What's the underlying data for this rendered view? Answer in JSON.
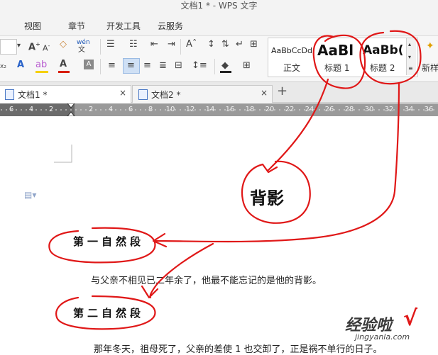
{
  "window": {
    "title": "文档1 * - WPS 文字"
  },
  "menu": {
    "items": [
      "视图",
      "章节",
      "开发工具",
      "云服务"
    ]
  },
  "ribbon": {
    "font_grow": "A",
    "font_shrink": "A",
    "pinyin": "wén",
    "styles": [
      {
        "preview": "AaBbCcDd",
        "label": "正文"
      },
      {
        "preview": "AaBl",
        "label": "标题 1"
      },
      {
        "preview": "AaBb(",
        "label": "标题 2"
      }
    ],
    "new_style": "新样"
  },
  "tabs": [
    {
      "label": "文档1 *",
      "close": "×"
    },
    {
      "label": "文档2 *",
      "close": "×"
    }
  ],
  "new_tab": "+",
  "ruler": {
    "left_ticks": [
      "6",
      "4",
      "2"
    ],
    "right_ticks": [
      "2",
      "4",
      "6",
      "8",
      "10",
      "12",
      "14",
      "16",
      "18",
      "20",
      "22",
      "24",
      "26",
      "28",
      "30",
      "32",
      "34",
      "36"
    ]
  },
  "document": {
    "heading1": "第一自然段",
    "para1": "与父亲不相见已二年余了，他最不能忘记的是他的背影。",
    "heading2": "第二自然段",
    "para2": "那年冬天，祖母死了，父亲的差使 1 也交卸了，正是祸不单行的日子。"
  },
  "annotation": {
    "label": "背影"
  },
  "watermark": {
    "text": "经验啦",
    "check": "√",
    "url": "jingyanla.com"
  },
  "colors": {
    "annotation_red": "#e01818",
    "ruler_dark": "#6b6b6b",
    "highlight_yellow": "#f5d000",
    "font_red": "#d81e06"
  }
}
